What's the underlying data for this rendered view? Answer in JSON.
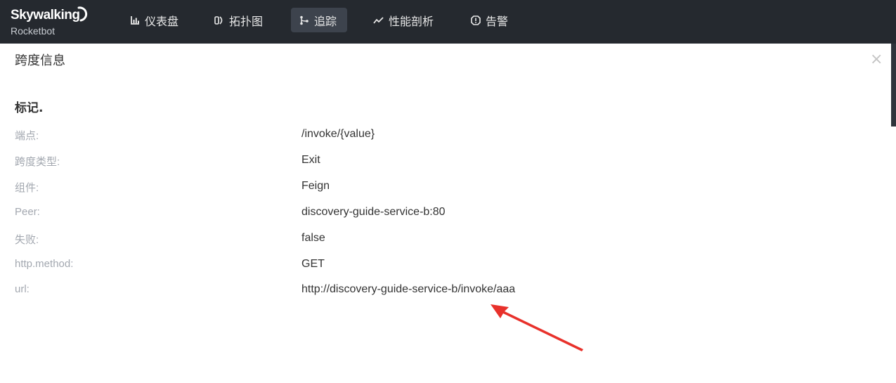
{
  "brand": {
    "name": "Skywalking",
    "subtitle": "Rocketbot"
  },
  "nav": {
    "items": [
      {
        "label": "仪表盘",
        "icon": "chart-icon"
      },
      {
        "label": "拓扑图",
        "icon": "topology-icon"
      },
      {
        "label": "追踪",
        "icon": "trace-icon",
        "active": true
      },
      {
        "label": "性能剖析",
        "icon": "trend-icon"
      },
      {
        "label": "告警",
        "icon": "alarm-icon"
      }
    ]
  },
  "panel": {
    "title": "跨度信息",
    "close_label": "×",
    "section_title": "标记.",
    "rows": [
      {
        "label": "端点:",
        "value": "/invoke/{value}"
      },
      {
        "label": "跨度类型:",
        "value": "Exit"
      },
      {
        "label": "组件:",
        "value": "Feign"
      },
      {
        "label": "Peer:",
        "value": "discovery-guide-service-b:80"
      },
      {
        "label": "失败:",
        "value": "false"
      },
      {
        "label": "http.method:",
        "value": "GET"
      },
      {
        "label": "url:",
        "value": "http://discovery-guide-service-b/invoke/aaa"
      }
    ]
  },
  "colors": {
    "topbar": "#25292f",
    "active_tab": "#3d434d",
    "annotation_arrow": "#e8312b"
  }
}
